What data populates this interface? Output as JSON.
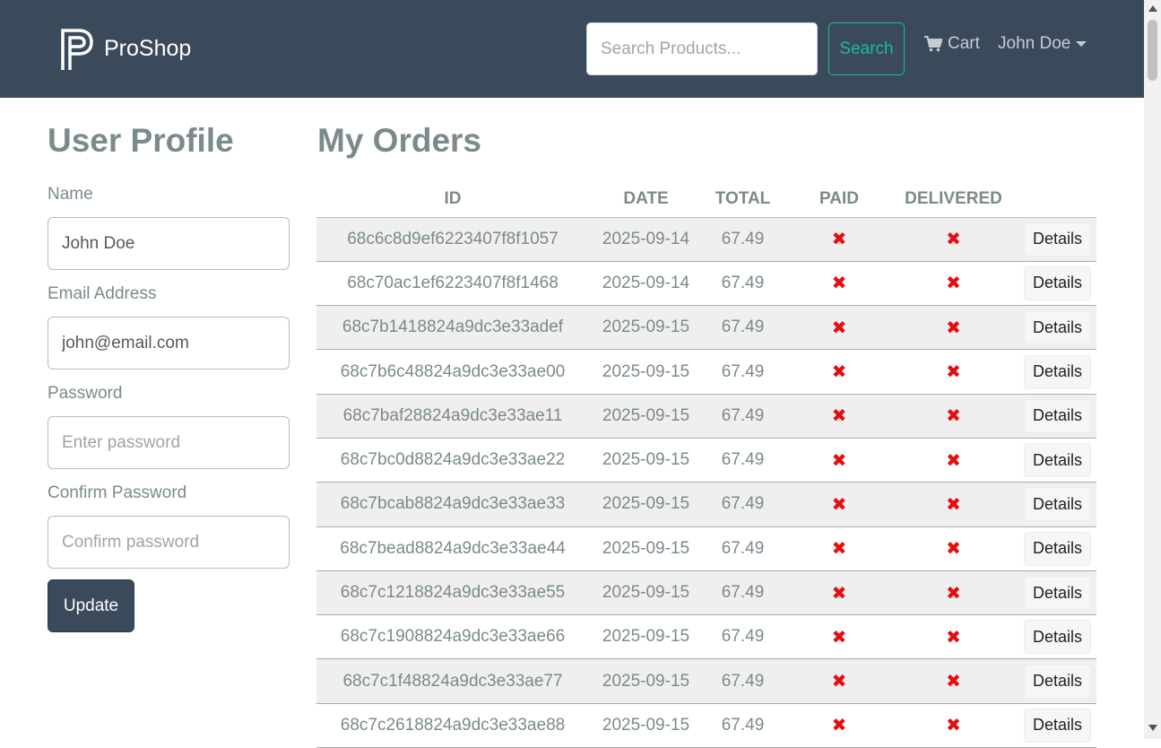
{
  "header": {
    "brand": "ProShop",
    "search_placeholder": "Search Products...",
    "search_label": "Search",
    "cart_label": "Cart",
    "user_name": "John Doe"
  },
  "profile": {
    "title": "User Profile",
    "fields": {
      "name": {
        "label": "Name",
        "value": "John Doe"
      },
      "email": {
        "label": "Email Address",
        "value": "john@email.com"
      },
      "password": {
        "label": "Password",
        "placeholder": "Enter password"
      },
      "confirm": {
        "label": "Confirm Password",
        "placeholder": "Confirm password"
      }
    },
    "update_label": "Update"
  },
  "orders": {
    "title": "My Orders",
    "columns": [
      "ID",
      "DATE",
      "TOTAL",
      "PAID",
      "DELIVERED",
      ""
    ],
    "paid_mark": "✖",
    "delivered_mark": "✖",
    "details_label": "Details",
    "rows": [
      {
        "id": "68c6c8d9ef6223407f8f1057",
        "date": "2025-09-14",
        "total": "67.49"
      },
      {
        "id": "68c70ac1ef6223407f8f1468",
        "date": "2025-09-14",
        "total": "67.49"
      },
      {
        "id": "68c7b1418824a9dc3e33adef",
        "date": "2025-09-15",
        "total": "67.49"
      },
      {
        "id": "68c7b6c48824a9dc3e33ae00",
        "date": "2025-09-15",
        "total": "67.49"
      },
      {
        "id": "68c7baf28824a9dc3e33ae11",
        "date": "2025-09-15",
        "total": "67.49"
      },
      {
        "id": "68c7bc0d8824a9dc3e33ae22",
        "date": "2025-09-15",
        "total": "67.49"
      },
      {
        "id": "68c7bcab8824a9dc3e33ae33",
        "date": "2025-09-15",
        "total": "67.49"
      },
      {
        "id": "68c7bead8824a9dc3e33ae44",
        "date": "2025-09-15",
        "total": "67.49"
      },
      {
        "id": "68c7c1218824a9dc3e33ae55",
        "date": "2025-09-15",
        "total": "67.49"
      },
      {
        "id": "68c7c1908824a9dc3e33ae66",
        "date": "2025-09-15",
        "total": "67.49"
      },
      {
        "id": "68c7c1f48824a9dc3e33ae77",
        "date": "2025-09-15",
        "total": "67.49"
      },
      {
        "id": "68c7c2618824a9dc3e33ae88",
        "date": "2025-09-15",
        "total": "67.49"
      }
    ]
  },
  "icons": {
    "logo": "proshop-logo",
    "cart": "cart-icon",
    "caret": "chevron-down-icon",
    "not_paid": "x-mark-icon",
    "not_delivered": "x-mark-icon"
  },
  "colors": {
    "navbar": "#3b4a5b",
    "accent": "#18bc9c",
    "danger": "#e80c0c",
    "heading": "#7b8a8b"
  }
}
